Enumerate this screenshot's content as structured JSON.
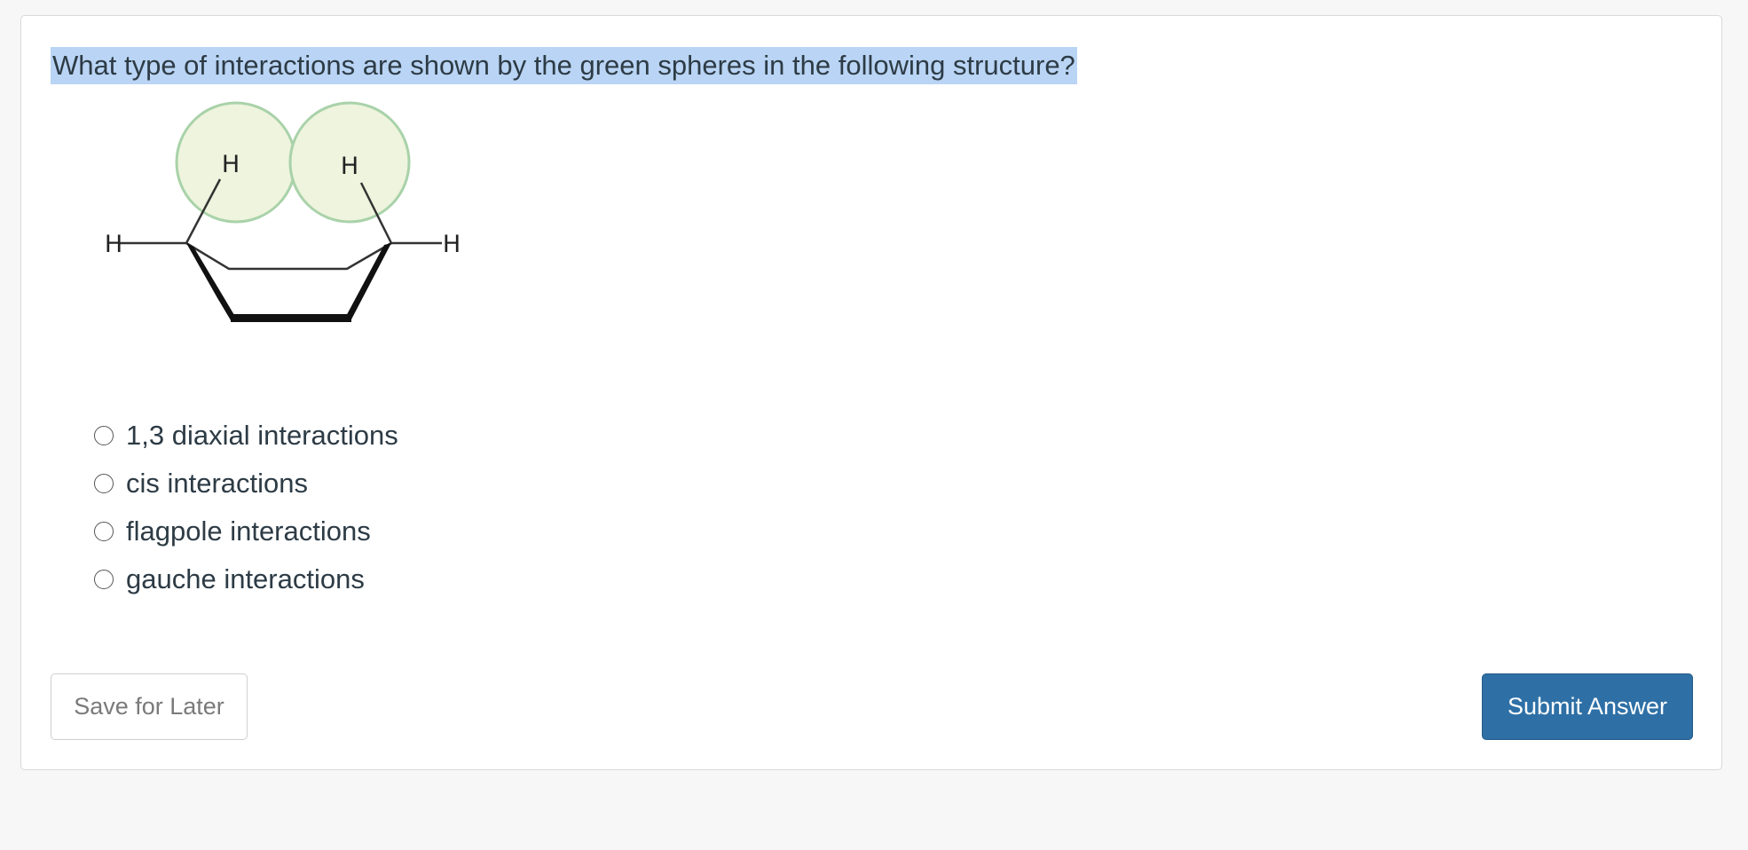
{
  "question": {
    "text": "What type of interactions are shown by the green spheres in the following structure?"
  },
  "structure": {
    "atom_labels": [
      "H",
      "H",
      "H",
      "H"
    ],
    "sphere_fill": "#eef4dd",
    "sphere_stroke": "#a9d2a9"
  },
  "choices": [
    {
      "label": "1,3 diaxial interactions",
      "selected": false
    },
    {
      "label": "cis interactions",
      "selected": false
    },
    {
      "label": "flagpole interactions",
      "selected": false
    },
    {
      "label": "gauche interactions",
      "selected": false
    }
  ],
  "actions": {
    "save_label": "Save for Later",
    "submit_label": "Submit Answer"
  },
  "colors": {
    "highlight": "#b9d4f4",
    "submit_bg": "#2e70a6"
  }
}
